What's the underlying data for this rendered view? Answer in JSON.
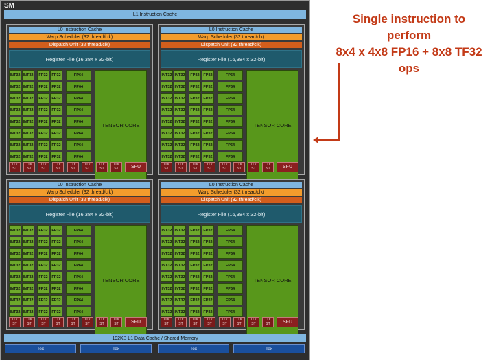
{
  "sm": {
    "label": "SM",
    "l1_instruction_cache": "L1 Instruction Cache",
    "data_cache": "192KB L1 Data Cache / Shared Memory",
    "tex_label": "Tex"
  },
  "quadrant": {
    "l0_cache": "L0 Instruction Cache",
    "warp_scheduler": "Warp Scheduler (32 thread/clk)",
    "dispatch_unit": "Dispatch Unit (32 thread/clk)",
    "register_file": "Register File (16,384 x 32-bit)",
    "int32": "INT32",
    "fp32": "FP32",
    "fp64": "FP64",
    "tensor_core": "TENSOR CORE",
    "ldst": "LD/ ST",
    "sfu": "SFU"
  },
  "callout": {
    "line1": "Single instruction to perform",
    "line2": "8x4 x 4x8 FP16 + 8x8 TF32 ops"
  },
  "colors": {
    "accent": "#c33a17",
    "green": "#6da82b",
    "register_file": "#1f5a6c",
    "scheduler": "#f39c2c"
  }
}
